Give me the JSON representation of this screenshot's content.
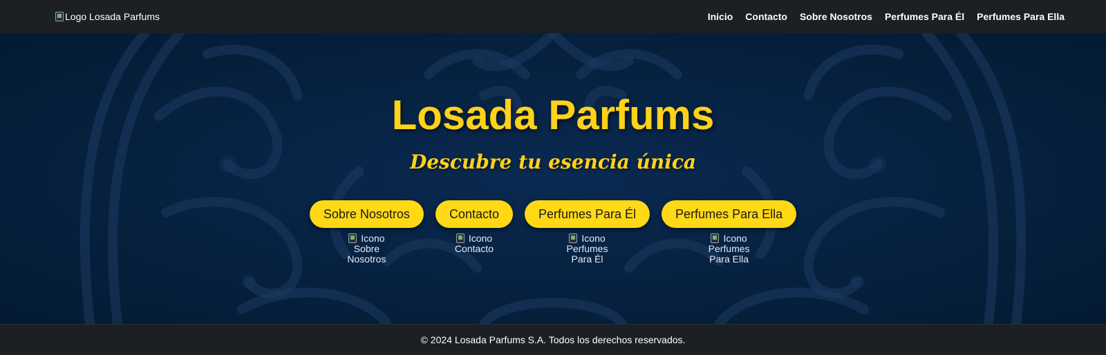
{
  "nav": {
    "logo_alt": "Logo Losada Parfums",
    "links": [
      "Inicio",
      "Contacto",
      "Sobre Nosotros",
      "Perfumes Para Él",
      "Perfumes Para Ella"
    ]
  },
  "hero": {
    "title": "Losada Parfums",
    "subtitle": "Descubre tu esencia única",
    "ctas": [
      {
        "label": "Sobre Nosotros",
        "icon_alt": "Icono Sobre Nosotros"
      },
      {
        "label": "Contacto",
        "icon_alt": "Icono Contacto"
      },
      {
        "label": "Perfumes Para Él",
        "icon_alt": "Icono Perfumes Para Él"
      },
      {
        "label": "Perfumes Para Ella",
        "icon_alt": "Icono Perfumes Para Ella"
      }
    ]
  },
  "footer": {
    "copyright": "© 2024 Losada Parfums S.A. Todos los derechos reservados."
  },
  "colors": {
    "accent": "#ffd816",
    "hero_bg": "#06213f",
    "nav_bg": "#1c1f23"
  }
}
